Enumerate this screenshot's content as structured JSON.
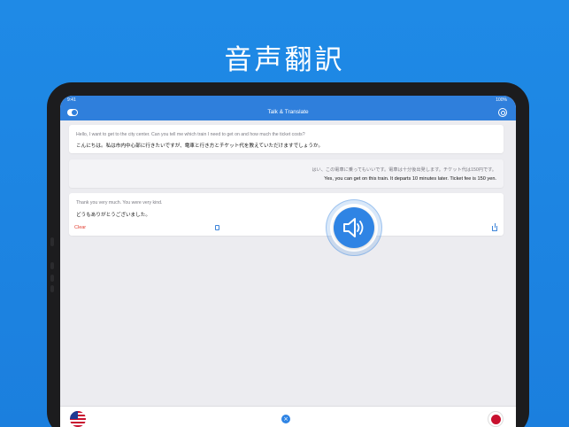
{
  "headline": "音声翻訳",
  "statusbar": {
    "time": "9:41",
    "battery": "100%"
  },
  "app": {
    "title": "Talk & Translate"
  },
  "conversation": [
    {
      "source": "Hello, I want to get to the city center. Can you tell me which train I need to get on and how much the ticket costs?",
      "translation": "こんにちは。私は市内中心部に行きたいですが、電車と行き方とチケット代を教えていただけますでしょうか。"
    },
    {
      "source": "はい、この電車に乗ってもいいです。電車は十分後出発します。チケット代は150円です。",
      "translation": "Yes, you can get on this train. It departs 10 minutes later. Ticket fee is 150 yen."
    },
    {
      "source": "Thank you very much. You were very kind.",
      "translation": "どうもありがとうございました。",
      "clear_label": "Clear"
    }
  ],
  "icons": {
    "toggle": "toggle-icon",
    "settings": "gear-icon",
    "copy": "copy-icon",
    "share": "share-icon",
    "speaker": "speaker-icon",
    "swap": "close-icon"
  },
  "colors": {
    "accent": "#2f7fdc",
    "clear": "#e23b2e",
    "background": "#1f8ae6"
  },
  "languages": {
    "left": "flag-us-icon",
    "right": "flag-jp-icon"
  }
}
